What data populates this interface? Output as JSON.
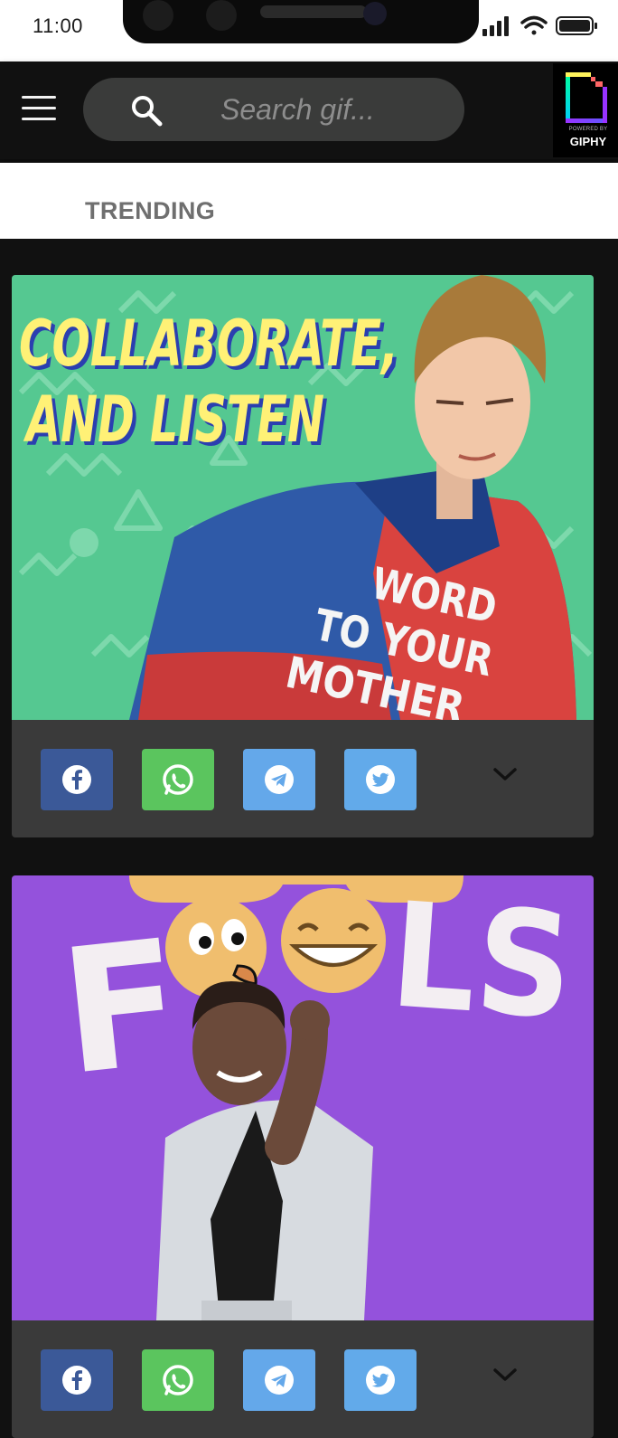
{
  "status_bar": {
    "time": "11:00"
  },
  "header": {
    "search_placeholder": "Search gif...",
    "badge": {
      "powered_by": "POWERED BY",
      "brand": "GIPHY"
    }
  },
  "tabs": {
    "active_label": "TRENDING"
  },
  "colors": {
    "background": "#111111",
    "card": "#3a3a3a",
    "facebook": "#3b5998",
    "whatsapp": "#5bc55e",
    "telegram": "#64a8ea",
    "twitter": "#62aaea"
  },
  "gifs": [
    {
      "caption_lines": [
        "COLLABORATE,",
        "AND LISTEN"
      ],
      "shirt_text": [
        "WORD",
        "TO YOUR",
        "MOTHER"
      ],
      "background": "#55c891"
    },
    {
      "caption_letters": [
        "F",
        "LS"
      ],
      "background": "#9452dc"
    }
  ],
  "share_icons": [
    "facebook-icon",
    "whatsapp-icon",
    "telegram-icon",
    "twitter-icon"
  ]
}
